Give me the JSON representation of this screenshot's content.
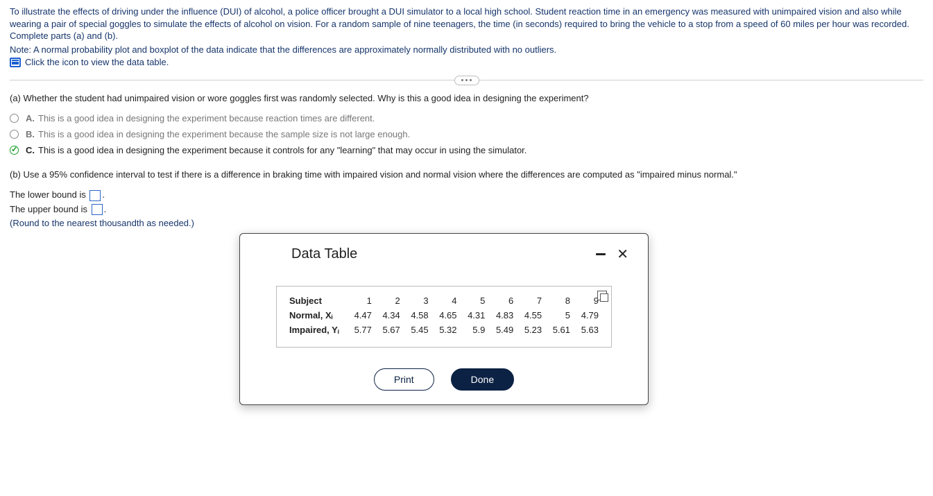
{
  "intro": {
    "line1": "To illustrate the effects of driving under the influence (DUI) of alcohol, a police officer brought a DUI simulator to a local high school. Student reaction time in an emergency was measured with unimpaired vision and also while wearing a pair of special goggles to simulate the effects of alcohol on vision. For a random sample of nine teenagers, the time (in seconds) required to bring the vehicle to a stop from a speed of 60 miles per hour was recorded. Complete parts (a) and (b).",
    "line2": "Note: A normal probability plot and boxplot of the data indicate that the differences are approximately normally distributed with no outliers.",
    "link_text": "Click the icon to view the data table."
  },
  "part_a": {
    "prompt": "(a) Whether the student had unimpaired vision or wore goggles first was randomly selected. Why is this a good idea in designing the experiment?",
    "options": {
      "A": "This is a good idea in designing the experiment because reaction times are different.",
      "B": "This is a good idea in designing the experiment because the sample size is not large enough.",
      "C": "This is a good idea in designing the experiment because it controls for any \"learning\" that may occur in using the simulator."
    },
    "selected": "C"
  },
  "part_b": {
    "prompt": "(b) Use a 95% confidence interval to test if there is a difference in braking time with impaired vision and normal vision where the differences are computed as \"impaired minus normal.\"",
    "lower_label_pre": "The lower bound is ",
    "upper_label_pre": "The upper bound is ",
    "period": ".",
    "hint": "(Round to the nearest thousandth as needed.)"
  },
  "modal": {
    "title": "Data Table",
    "buttons": {
      "print": "Print",
      "done": "Done"
    },
    "rows": {
      "subject_label": "Subject",
      "normal_label": "Normal, Xᵢ",
      "impaired_label": "Impaired, Yᵢ"
    }
  },
  "chart_data": {
    "type": "table",
    "columns": [
      "1",
      "2",
      "3",
      "4",
      "5",
      "6",
      "7",
      "8",
      "9"
    ],
    "series": [
      {
        "name": "Normal, Xᵢ",
        "values": [
          4.47,
          4.34,
          4.58,
          4.65,
          4.31,
          4.83,
          4.55,
          5.0,
          4.79
        ]
      },
      {
        "name": "Impaired, Yᵢ",
        "values": [
          5.77,
          5.67,
          5.45,
          5.32,
          5.9,
          5.49,
          5.23,
          5.61,
          5.63
        ]
      }
    ]
  }
}
